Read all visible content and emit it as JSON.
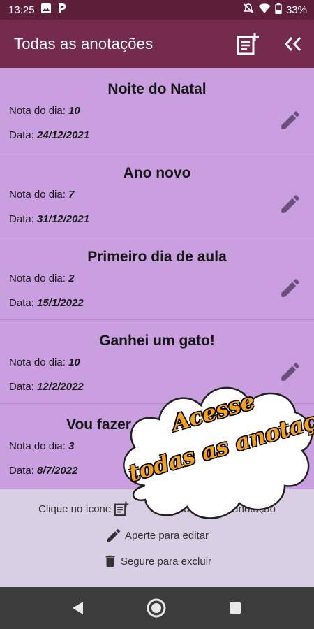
{
  "status_bar": {
    "time": "13:25",
    "battery": "33%",
    "icons": [
      "gallery-icon",
      "parking-p-icon",
      "bell-off-icon",
      "wifi-icon",
      "battery-icon"
    ]
  },
  "app_bar": {
    "title": "Todas as anotações",
    "actions": [
      "add-note-icon",
      "double-chevron-left-icon"
    ]
  },
  "notes": [
    {
      "title": "Noite do Natal",
      "grade_label": "Nota do dia:",
      "grade": "10",
      "date_label": "Data:",
      "date": "24/12/2021"
    },
    {
      "title": "Ano novo",
      "grade_label": "Nota do dia:",
      "grade": "7",
      "date_label": "Data:",
      "date": "31/12/2021"
    },
    {
      "title": "Primeiro dia de aula",
      "grade_label": "Nota do dia:",
      "grade": "2",
      "date_label": "Data:",
      "date": "15/1/2022"
    },
    {
      "title": "Ganhei um gato!",
      "grade_label": "Nota do dia:",
      "grade": "10",
      "date_label": "Data:",
      "date": "12/2/2022"
    },
    {
      "title": "Vou fazer",
      "grade_label": "Nota do dia:",
      "grade": "3",
      "date_label": "Data:",
      "date": "8/7/2022"
    }
  ],
  "help": {
    "line1_pre": "Clique no ícone",
    "line1_post": "uma nova anotação",
    "line2": "Aperte para editar",
    "line3": "Segure para excluir"
  },
  "promo": {
    "line1": "Acesse",
    "line2": "todas as  anotações"
  },
  "colors": {
    "status_bar": "#5e1f3a",
    "app_bar": "#742b4d",
    "list_bg": "#c99fe0",
    "help_bg": "#d9cfe4",
    "nav_bar": "#3c3c3c",
    "promo_text": "#f5a21a"
  }
}
